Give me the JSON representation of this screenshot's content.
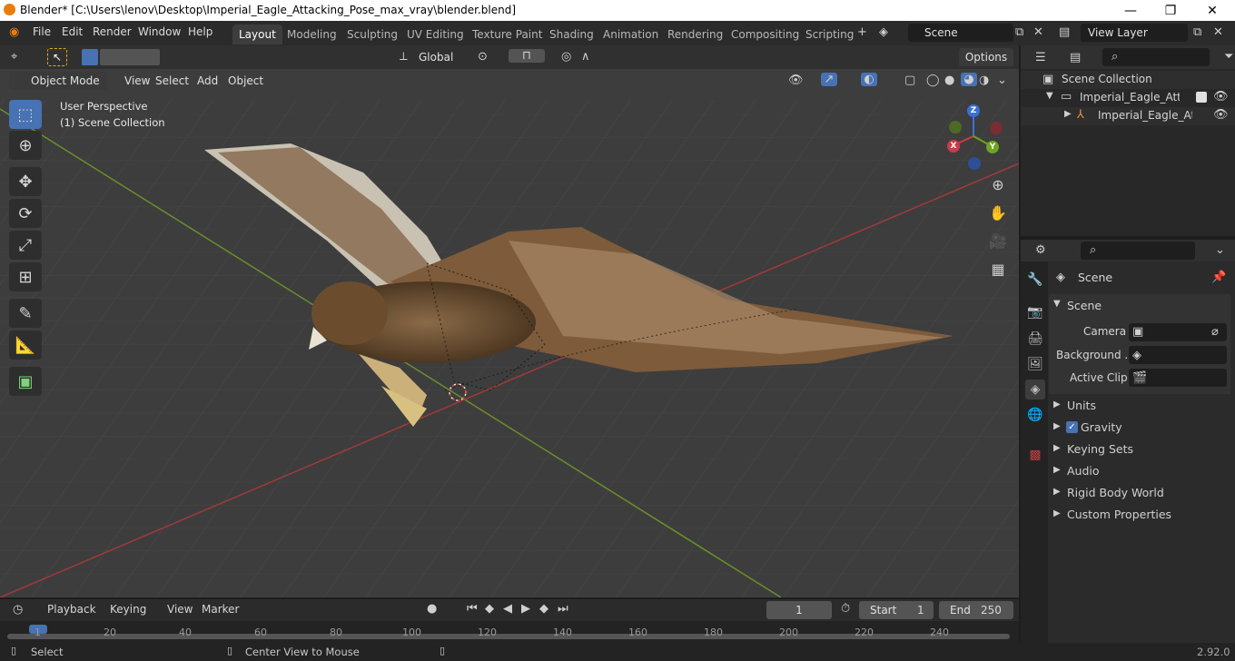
{
  "window": {
    "title": "Blender* [C:\\Users\\lenov\\Desktop\\Imperial_Eagle_Attacking_Pose_max_vray\\blender.blend]",
    "minimize": "—",
    "maximize": "❐",
    "close": "✕"
  },
  "menus": [
    "File",
    "Edit",
    "Render",
    "Window",
    "Help"
  ],
  "workspaces": [
    "Layout",
    "Modeling",
    "Sculpting",
    "UV Editing",
    "Texture Paint",
    "Shading",
    "Animation",
    "Rendering",
    "Compositing",
    "Scripting"
  ],
  "scene_field": "Scene",
  "view_layer_field": "View Layer",
  "viewport": {
    "transform_orientation": "Global",
    "options": "Options",
    "mode": "Object Mode",
    "menus": [
      "View",
      "Select",
      "Add",
      "Object"
    ],
    "overlay_title": "User Perspective",
    "overlay_collection": "(1) Scene Collection"
  },
  "gizmo": {
    "z": "Z",
    "x": "X",
    "y": "Y"
  },
  "outliner": {
    "root": "Scene Collection",
    "collection": "Imperial_Eagle_Attacking",
    "object": "Imperial_Eagle_Attac"
  },
  "properties": {
    "header": "Scene",
    "panel": "Scene",
    "camera_label": "Camera",
    "background_label": "Background ...",
    "active_clip_label": "Active Clip",
    "sections": [
      "Units",
      "Gravity",
      "Keying Sets",
      "Audio",
      "Rigid Body World",
      "Custom Properties"
    ],
    "gravity_checked": true
  },
  "timeline": {
    "menus": [
      "Playback",
      "Keying",
      "View",
      "Marker"
    ],
    "current_frame": "1",
    "start_label": "Start",
    "start": "1",
    "end_label": "End",
    "end": "250",
    "ruler": [
      "1",
      "20",
      "40",
      "60",
      "80",
      "100",
      "120",
      "140",
      "160",
      "180",
      "200",
      "220",
      "240"
    ]
  },
  "statusbar": {
    "select": "Select",
    "center": "Center View to Mouse",
    "version": "2.92.0"
  },
  "colors": {
    "accent": "#4772b3",
    "x_axis": "#a03a3a",
    "y_axis": "#6a8f2a"
  }
}
